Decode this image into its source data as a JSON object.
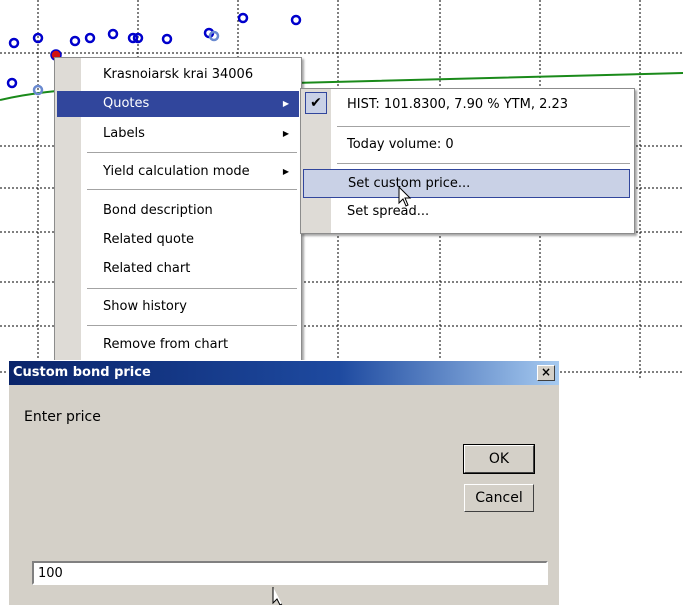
{
  "context_menu": {
    "items": [
      {
        "label": "Krasnoiarsk krai 34006",
        "submenu": false
      },
      {
        "label": "Quotes",
        "submenu": true,
        "highlighted": true
      },
      {
        "label": "Labels",
        "submenu": true
      },
      {
        "label": "Yield calculation mode",
        "submenu": true
      },
      {
        "label": "Bond description",
        "submenu": false
      },
      {
        "label": "Related quote",
        "submenu": false
      },
      {
        "label": "Related chart",
        "submenu": false
      },
      {
        "label": "Show history",
        "submenu": false
      },
      {
        "label": "Remove from chart",
        "submenu": false
      }
    ]
  },
  "quotes_submenu": {
    "items": [
      {
        "label": "HIST: 101.8300, 7.90 % YTM, 2.23",
        "checked": true
      },
      {
        "label": "Today volume: 0"
      },
      {
        "label": "Set custom price...",
        "highlighted": true
      },
      {
        "label": "Set spread..."
      }
    ]
  },
  "dialog": {
    "title": "Custom bond price",
    "close_label": "×",
    "prompt": "Enter price",
    "ok_label": "OK",
    "cancel_label": "Cancel",
    "price_value": "100"
  },
  "colors": {
    "menu_highlight": "#31469c",
    "submenu_highlight": "#c9d1e6",
    "curve": "#1a8a1a",
    "points": "#0000cc",
    "selected_point": "#d01010",
    "dialog_face": "#d4d0c8",
    "titlebar": "#0a246a"
  },
  "icons": {
    "submenu_arrow": "triangle-right-icon",
    "check": "checkmark-icon",
    "cursor": "mouse-pointer-icon"
  }
}
